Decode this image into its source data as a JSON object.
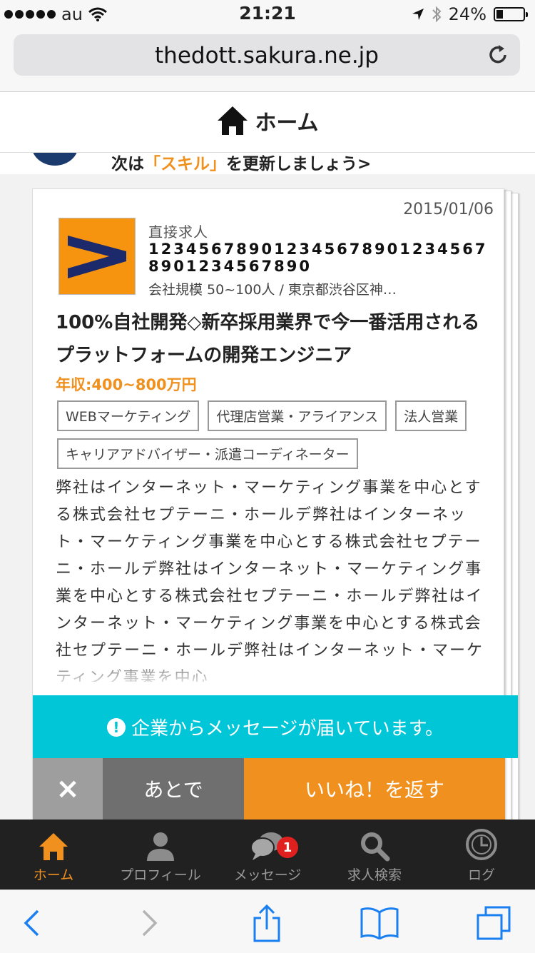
{
  "status_bar": {
    "carrier": "au",
    "time": "21:21",
    "battery": "24%"
  },
  "browser": {
    "url": "thedott.sakura.ne.jp"
  },
  "header": {
    "title": "ホーム"
  },
  "skill_banner": {
    "prefix": "次は",
    "highlight": "「スキル」",
    "suffix": "を更新しましょう>"
  },
  "card": {
    "date": "2015/01/06",
    "kind": "直接求人",
    "company_name": "1234567890123456789012345678901234567890",
    "company_info": "会社規模 50~100人 / 東京都渋谷区神…",
    "job_title": "100%自社開発◇新卒採用業界で今一番活用されるプラットフォームの開発エンジニア",
    "salary": "年収:400~800万円",
    "tags": [
      "WEBマーケティング",
      "代理店営業・アライアンス",
      "法人営業",
      "キャリアアドバイザー・派遣コーディネーター"
    ],
    "description": "弊社はインターネット・マーケティング事業を中心とする株式会社セプテーニ・ホールデ弊社はインターネット・マーケティング事業を中心とする株式会社セプテーニ・ホールデ弊社はインターネット・マーケティング事業を中心とする株式会社セプテーニ・ホールデ弊社はインターネット・マーケティング事業を中心とする株式会社セプテーニ・ホールデ弊社はインターネット・マーケティング事業を中心"
  },
  "message_bar": {
    "text": "企業からメッセージが届いています。"
  },
  "actions": {
    "close": "×",
    "later": "あとで",
    "like_back": "いいね！を返す"
  },
  "tabs": [
    {
      "label": "ホーム",
      "icon": "home-icon"
    },
    {
      "label": "プロフィール",
      "icon": "person-icon"
    },
    {
      "label": "メッセージ",
      "icon": "chat-icon",
      "badge": "1"
    },
    {
      "label": "求人検索",
      "icon": "search-icon"
    },
    {
      "label": "ログ",
      "icon": "clock-icon"
    }
  ],
  "colors": {
    "accent_orange": "#f0901e",
    "message_cyan": "#00c6d8",
    "tabbar_bg": "#212121",
    "ios_blue": "#1a7ff0"
  }
}
